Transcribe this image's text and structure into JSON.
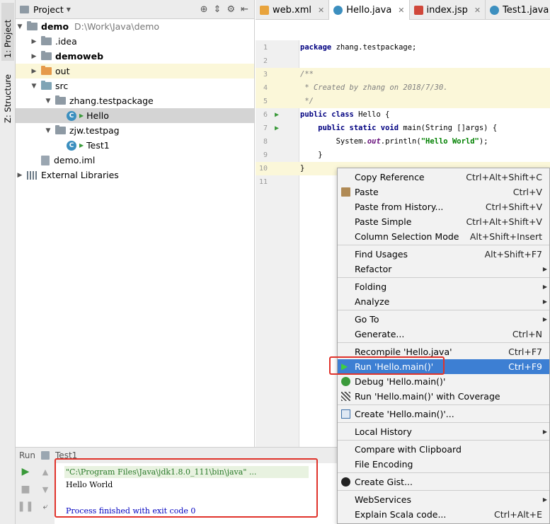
{
  "left_strip": {
    "project_tab": "1: Project",
    "structure_tab": "Z: Structure"
  },
  "project_panel": {
    "title": "Project",
    "tree": [
      {
        "label": "demo",
        "path": "D:\\Work\\Java\\demo"
      },
      {
        "label": ".idea"
      },
      {
        "label": "demoweb"
      },
      {
        "label": "out"
      },
      {
        "label": "src"
      },
      {
        "label": "zhang.testpackage"
      },
      {
        "label": "Hello"
      },
      {
        "label": "zjw.testpag"
      },
      {
        "label": "Test1"
      },
      {
        "label": "demo.iml"
      },
      {
        "label": "External Libraries"
      }
    ]
  },
  "editor_tabs": [
    {
      "label": "web.xml",
      "icon": "xml-file-icon"
    },
    {
      "label": "Hello.java",
      "icon": "java-class-icon"
    },
    {
      "label": "index.jsp",
      "icon": "jsp-file-icon"
    },
    {
      "label": "Test1.java",
      "icon": "java-class-icon"
    }
  ],
  "editor": {
    "lines": [
      {
        "n": "1",
        "code": ""
      },
      {
        "n": "2",
        "code": ""
      },
      {
        "n": "3",
        "code": ""
      },
      {
        "n": "4",
        "code": ""
      },
      {
        "n": "5",
        "code": ""
      },
      {
        "n": "6",
        "code": ""
      },
      {
        "n": "7",
        "code": ""
      },
      {
        "n": "8",
        "code": ""
      },
      {
        "n": "9",
        "code": ""
      },
      {
        "n": "10",
        "code": ""
      },
      {
        "n": "11",
        "code": ""
      }
    ],
    "code": {
      "l1_kw": "package",
      "l1_rest": " zhang.testpackage;",
      "l3": "/**",
      "l4": " * Created by zhang on 2018/7/30.",
      "l5": " */",
      "l6_kw": "public class",
      "l6_rest": " Hello {",
      "l7_kw": "    public static void",
      "l7_rest": " main(String []args) {",
      "l8_pre": "        System.",
      "l8_fld": "out",
      "l8_mid": ".println(",
      "l8_str": "\"Hello World\"",
      "l8_end": ");",
      "l9": "    }",
      "l10": "}"
    }
  },
  "run_panel": {
    "label": "Run",
    "config": "Test1",
    "console": {
      "cmd": "\"C:\\Program Files\\Java\\jdk1.8.0_111\\bin\\java\" ...",
      "output": "Hello World",
      "exit": "Process finished with exit code 0"
    }
  },
  "context_menu": {
    "items": [
      {
        "label": "Copy Reference",
        "shortcut": "Ctrl+Alt+Shift+C"
      },
      {
        "label": "Paste",
        "shortcut": "Ctrl+V"
      },
      {
        "label": "Paste from History...",
        "shortcut": "Ctrl+Shift+V"
      },
      {
        "label": "Paste Simple",
        "shortcut": "Ctrl+Alt+Shift+V"
      },
      {
        "label": "Column Selection Mode",
        "shortcut": "Alt+Shift+Insert"
      },
      {
        "label": "Find Usages",
        "shortcut": "Alt+Shift+F7"
      },
      {
        "label": "Refactor",
        "shortcut": ""
      },
      {
        "label": "Folding",
        "shortcut": ""
      },
      {
        "label": "Analyze",
        "shortcut": ""
      },
      {
        "label": "Go To",
        "shortcut": ""
      },
      {
        "label": "Generate...",
        "shortcut": "Ctrl+N"
      },
      {
        "label": "Recompile 'Hello.java'",
        "shortcut": "Ctrl+F7"
      },
      {
        "label": "Run 'Hello.main()'",
        "shortcut": "Ctrl+F9"
      },
      {
        "label": "Debug 'Hello.main()'",
        "shortcut": ""
      },
      {
        "label": "Run 'Hello.main()' with Coverage",
        "shortcut": ""
      },
      {
        "label": "Create 'Hello.main()'...",
        "shortcut": ""
      },
      {
        "label": "Local History",
        "shortcut": ""
      },
      {
        "label": "Compare with Clipboard",
        "shortcut": ""
      },
      {
        "label": "File Encoding",
        "shortcut": ""
      },
      {
        "label": "Create Gist...",
        "shortcut": ""
      },
      {
        "label": "WebServices",
        "shortcut": ""
      },
      {
        "label": "Explain Scala code...",
        "shortcut": "Ctrl+Alt+E"
      }
    ]
  },
  "colors": {
    "highlight": "#3d7fd3",
    "annotation_box": "#e0332b",
    "run_green": "#3a9a3a"
  }
}
